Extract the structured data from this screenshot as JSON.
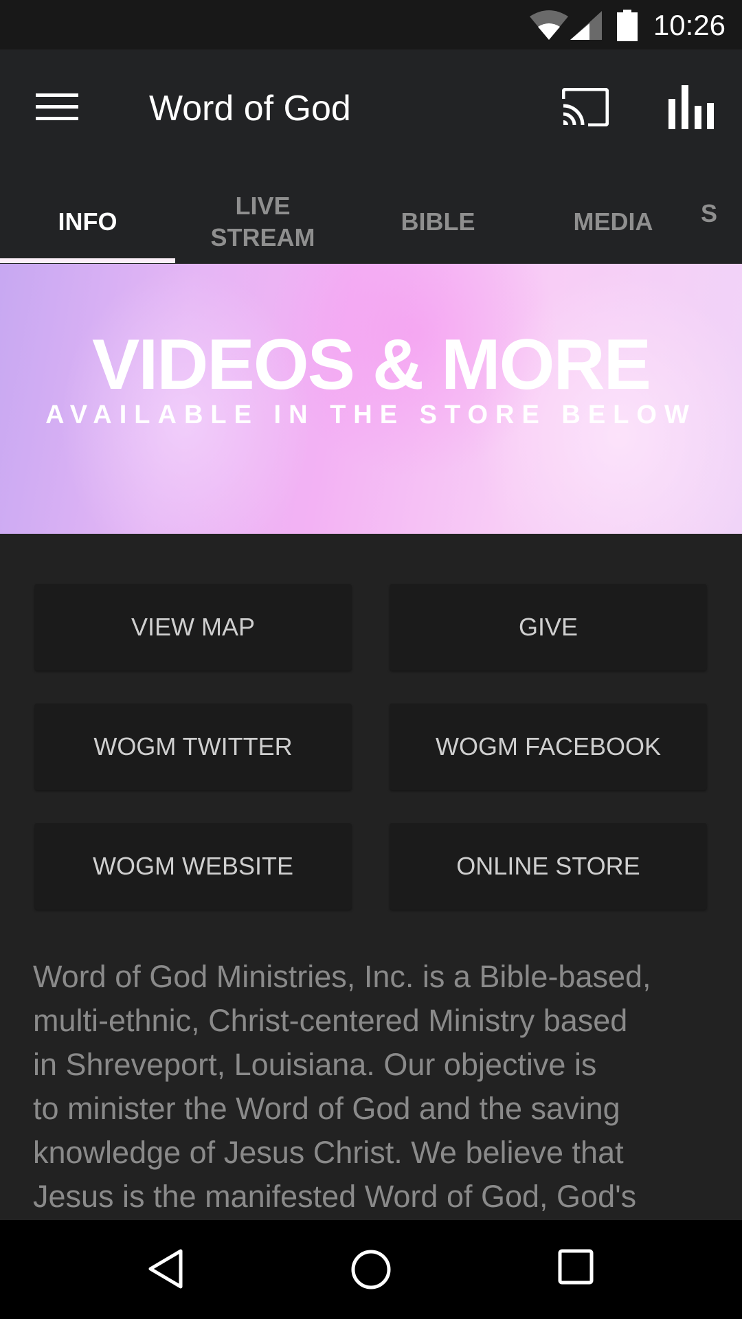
{
  "status_bar": {
    "time": "10:26",
    "icons": [
      "wifi-icon",
      "cellular-signal-icon",
      "battery-icon"
    ]
  },
  "app_bar": {
    "title": "Word of God",
    "left_icon": "menu-icon",
    "right_icons": [
      "cast-icon",
      "bar-chart-icon"
    ]
  },
  "tabs": [
    {
      "label": "INFO",
      "active": true
    },
    {
      "label": "LIVE\nSTREAM",
      "active": false
    },
    {
      "label": "BIBLE",
      "active": false
    },
    {
      "label": "MEDIA",
      "active": false
    },
    {
      "label": "S",
      "active": false
    }
  ],
  "banner": {
    "title": "VIDEOS & MORE",
    "subtitle": "AVAILABLE IN THE STORE BELOW"
  },
  "buttons": [
    {
      "label": "VIEW MAP"
    },
    {
      "label": "GIVE"
    },
    {
      "label": "WOGM TWITTER"
    },
    {
      "label": "WOGM FACEBOOK"
    },
    {
      "label": "WOGM WEBSITE"
    },
    {
      "label": "ONLINE STORE"
    }
  ],
  "about_text": "Word of God Ministries, Inc. is a Bible-based,\nmulti-ethnic, Christ-centered Ministry based\nin Shreveport, Louisiana.  Our objective is\nto minister the Word of God and the saving\nknowledge of Jesus Christ. We believe that\nJesus is the manifested Word of God, God's",
  "nav_bar": {
    "icons": [
      "back-icon",
      "home-icon",
      "recents-icon"
    ]
  },
  "colors": {
    "app_bar_bg": "#222325",
    "content_bg": "#222222",
    "button_bg": "#1b1b1b",
    "tab_indicator": "#fbeff8",
    "banner_accent": "#f3b2f4"
  }
}
